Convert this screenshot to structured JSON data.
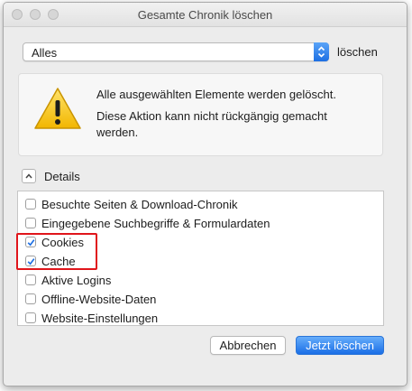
{
  "window": {
    "title": "Gesamte Chronik löschen"
  },
  "range": {
    "selected": "Alles",
    "clear_label": "löschen"
  },
  "warning": {
    "line1": "Alle ausgewählten Elemente werden gelöscht.",
    "line2": "Diese Aktion kann nicht rückgängig gemacht werden."
  },
  "details": {
    "label": "Details"
  },
  "items": [
    {
      "label": "Besuchte Seiten & Download-Chronik",
      "checked": false
    },
    {
      "label": "Eingegebene Suchbegriffe & Formulardaten",
      "checked": false
    },
    {
      "label": "Cookies",
      "checked": true
    },
    {
      "label": "Cache",
      "checked": true
    },
    {
      "label": "Aktive Logins",
      "checked": false
    },
    {
      "label": "Offline-Website-Daten",
      "checked": false
    },
    {
      "label": "Website-Einstellungen",
      "checked": false
    }
  ],
  "buttons": {
    "cancel": "Abbrechen",
    "confirm": "Jetzt löschen"
  },
  "colors": {
    "accent": "#1d6fe3",
    "highlight": "#e0151b"
  }
}
